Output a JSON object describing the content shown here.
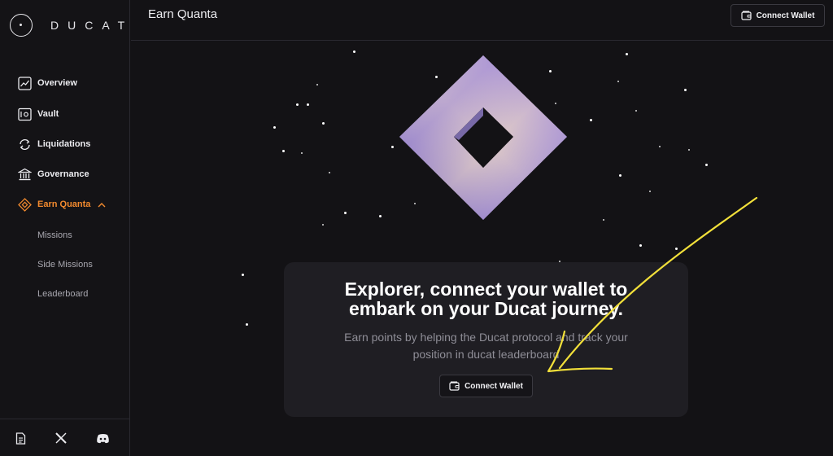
{
  "brand": {
    "name": "DUCAT"
  },
  "header": {
    "title": "Earn Quanta",
    "connect_label": "Connect Wallet"
  },
  "sidebar": {
    "items": [
      {
        "label": "Overview",
        "icon": "chart-line-icon"
      },
      {
        "label": "Vault",
        "icon": "vault-icon"
      },
      {
        "label": "Liquidations",
        "icon": "exchange-icon"
      },
      {
        "label": "Governance",
        "icon": "bank-icon"
      },
      {
        "label": "Earn Quanta",
        "icon": "diamond-icon",
        "active": true,
        "expanded": true
      }
    ],
    "subitems": [
      {
        "label": "Missions"
      },
      {
        "label": "Side Missions"
      },
      {
        "label": "Leaderboard"
      }
    ],
    "bottom_icons": [
      "document-icon",
      "x-logo-icon",
      "discord-icon"
    ]
  },
  "card": {
    "title_line1": "Explorer, connect your wallet to",
    "title_line2": "embark on your Ducat journey.",
    "subtitle_line1": "Earn points by helping the Ducat protocol and track your",
    "subtitle_line2": "position in ducat leaderboard",
    "button_label": "Connect Wallet"
  },
  "colors": {
    "background": "#131215",
    "card": "#1f1e23",
    "accent": "#f28a2e",
    "annotation": "#f2e03a"
  }
}
